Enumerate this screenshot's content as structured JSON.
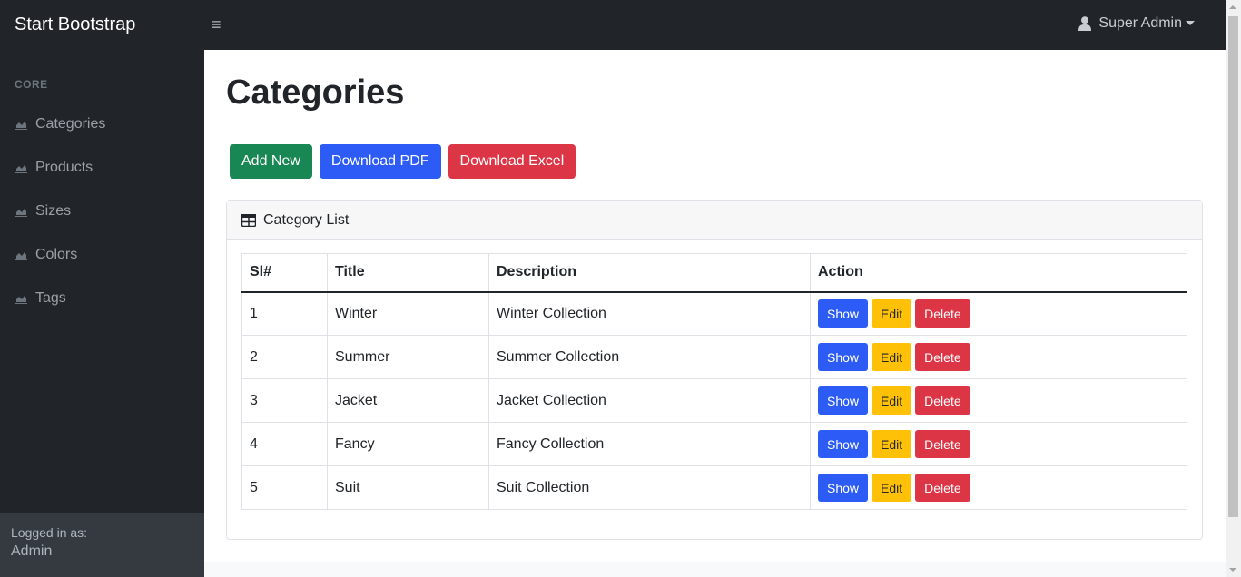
{
  "navbar": {
    "brand": "Start Bootstrap",
    "toggle_icon": "bars-icon",
    "user_label": "Super Admin",
    "user_icon": "user-icon"
  },
  "sidebar": {
    "heading": "CORE",
    "items": [
      {
        "label": "Categories",
        "icon": "chart-area-icon"
      },
      {
        "label": "Products",
        "icon": "chart-area-icon"
      },
      {
        "label": "Sizes",
        "icon": "chart-area-icon"
      },
      {
        "label": "Colors",
        "icon": "chart-area-icon"
      },
      {
        "label": "Tags",
        "icon": "chart-area-icon"
      }
    ],
    "footer": {
      "label": "Logged in as:",
      "name": "Admin"
    }
  },
  "main": {
    "title": "Categories",
    "buttons": {
      "add_new": "Add New",
      "download_pdf": "Download PDF",
      "download_excel": "Download Excel"
    },
    "card": {
      "title": "Category List",
      "icon": "table-icon",
      "columns": [
        "Sl#",
        "Title",
        "Description",
        "Action"
      ],
      "rows": [
        {
          "sl": "1",
          "title": "Winter",
          "description": "Winter Collection"
        },
        {
          "sl": "2",
          "title": "Summer",
          "description": "Summer Collection"
        },
        {
          "sl": "3",
          "title": "Jacket",
          "description": "Jacket Collection"
        },
        {
          "sl": "4",
          "title": "Fancy",
          "description": "Fancy Collection"
        },
        {
          "sl": "5",
          "title": "Suit",
          "description": "Suit Collection"
        }
      ],
      "actions": {
        "show": "Show",
        "edit": "Edit",
        "delete": "Delete"
      }
    }
  },
  "colors": {
    "navbar_bg": "#212529",
    "success": "#198754",
    "primary": "#2c5cf5",
    "danger": "#dc3545",
    "warning": "#ffc107"
  }
}
